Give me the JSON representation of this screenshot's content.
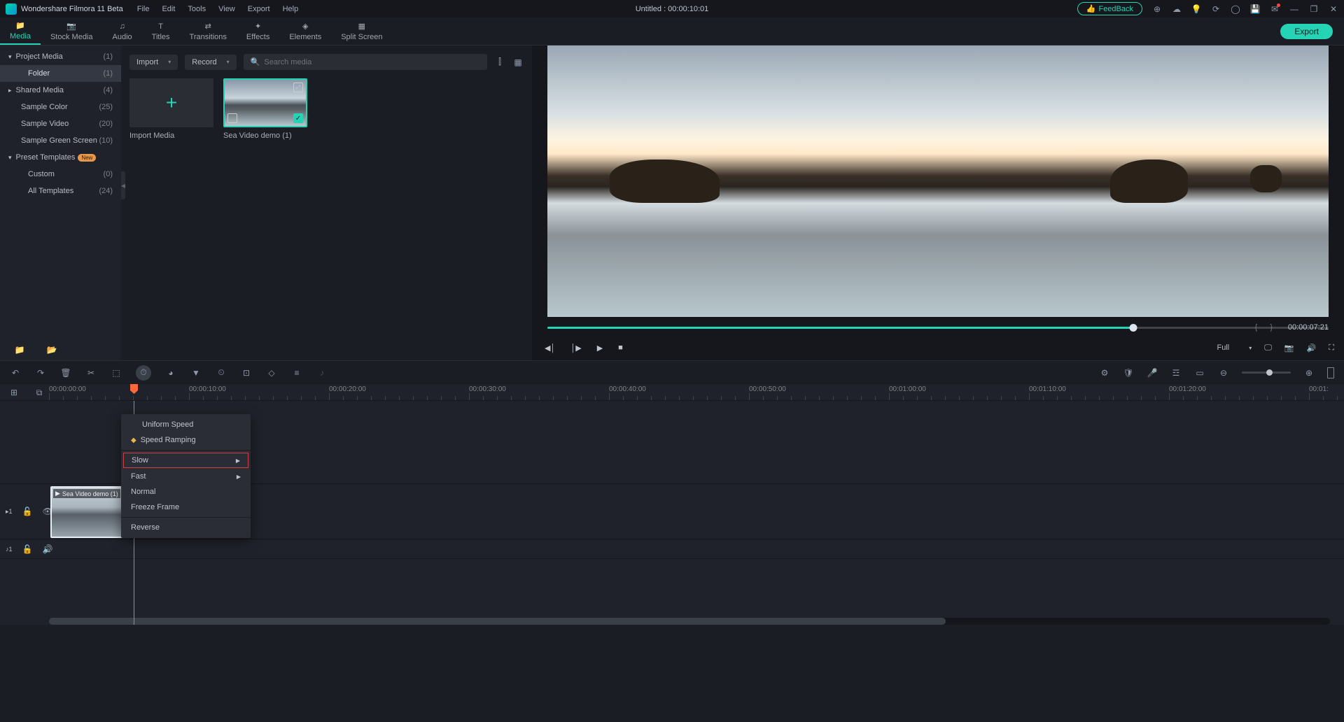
{
  "app": {
    "title": "Wondershare Filmora 11 Beta"
  },
  "menu": [
    "File",
    "Edit",
    "Tools",
    "View",
    "Export",
    "Help"
  ],
  "project_title": "Untitled : 00:00:10:01",
  "feedback": "FeedBack",
  "tabs": [
    {
      "label": "Media",
      "active": true
    },
    {
      "label": "Stock Media"
    },
    {
      "label": "Audio"
    },
    {
      "label": "Titles"
    },
    {
      "label": "Transitions"
    },
    {
      "label": "Effects"
    },
    {
      "label": "Elements"
    },
    {
      "label": "Split Screen"
    }
  ],
  "export": "Export",
  "sidebar": {
    "items": [
      {
        "label": "Project Media",
        "count": "(1)",
        "type": "expandable",
        "expanded": true
      },
      {
        "label": "Folder",
        "count": "(1)",
        "type": "indent",
        "active": true
      },
      {
        "label": "Shared Media",
        "count": "(4)",
        "type": "expandable"
      },
      {
        "label": "Sample Color",
        "count": "(25)",
        "type": "indent-plain"
      },
      {
        "label": "Sample Video",
        "count": "(20)",
        "type": "indent-plain"
      },
      {
        "label": "Sample Green Screen",
        "count": "(10)",
        "type": "indent-plain"
      },
      {
        "label": "Preset Templates",
        "count": "",
        "type": "expandable",
        "expanded": true,
        "new": true
      },
      {
        "label": "Custom",
        "count": "(0)",
        "type": "indent"
      },
      {
        "label": "All Templates",
        "count": "(24)",
        "type": "indent"
      }
    ]
  },
  "media_toolbar": {
    "import": "Import",
    "record": "Record",
    "search": "Search media"
  },
  "media_items": [
    {
      "label": "Import Media",
      "type": "import"
    },
    {
      "label": "Sea Video demo (1)",
      "type": "video"
    }
  ],
  "preview": {
    "time": "00:00:07:21",
    "quality": "Full"
  },
  "timeline": {
    "times": [
      "00:00:00:00",
      "00:00:10:00",
      "00:00:20:00",
      "00:00:30:00",
      "00:00:40:00",
      "00:00:50:00",
      "00:01:00:00",
      "00:01:10:00",
      "00:01:20:00",
      "00:01:"
    ]
  },
  "clip": {
    "label": "Sea Video demo (1)"
  },
  "track_labels": {
    "video": "1",
    "audio": "1"
  },
  "context_menu": {
    "items": [
      {
        "label": "Uniform Speed",
        "icon": false
      },
      {
        "label": "Speed Ramping",
        "icon": true
      },
      {
        "sep": true
      },
      {
        "label": "Slow",
        "arrow": true,
        "highlighted": true
      },
      {
        "label": "Fast",
        "arrow": true
      },
      {
        "label": "Normal"
      },
      {
        "label": "Freeze Frame"
      },
      {
        "sep": true
      },
      {
        "label": "Reverse"
      }
    ]
  }
}
